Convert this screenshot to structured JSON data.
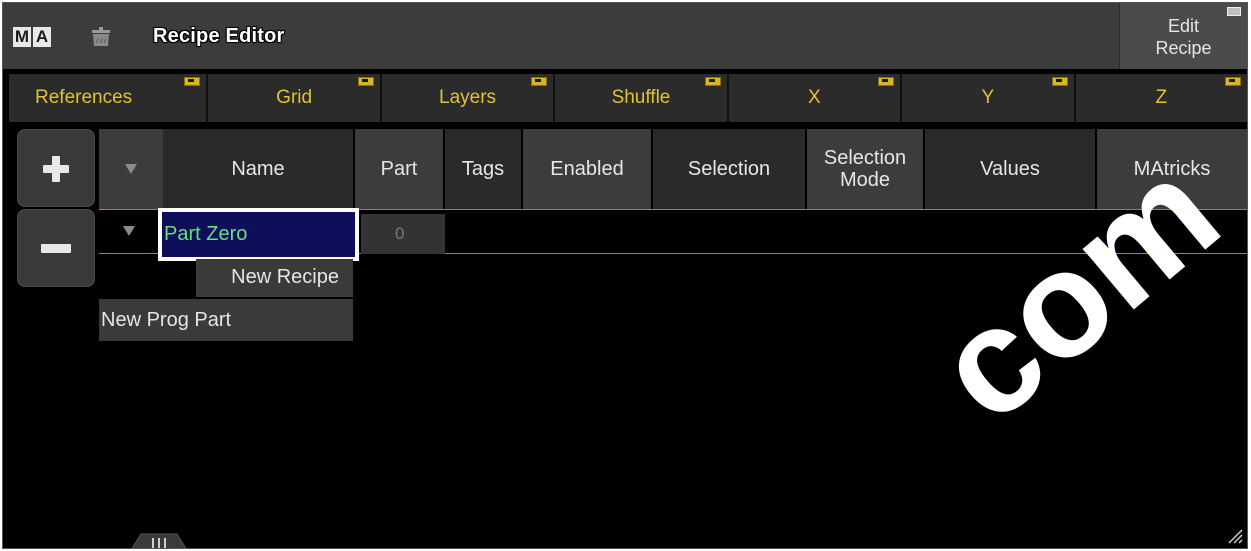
{
  "window": {
    "logo": [
      "M",
      "A"
    ],
    "title": "Recipe Editor",
    "edit_button": {
      "line1": "Edit",
      "line2": "Recipe"
    }
  },
  "tabs": [
    {
      "label": "References"
    },
    {
      "label": "Grid"
    },
    {
      "label": "Layers"
    },
    {
      "label": "Shuffle"
    },
    {
      "label": "X"
    },
    {
      "label": "Y"
    },
    {
      "label": "Z"
    }
  ],
  "columns": {
    "name": "Name",
    "part": "Part",
    "tags": "Tags",
    "enabled": "Enabled",
    "selection": "Selection",
    "selection_mode_line1": "Selection",
    "selection_mode_line2": "Mode",
    "values": "Values",
    "matricks": "MAtricks"
  },
  "rows": [
    {
      "name": "Part Zero",
      "part": "0"
    }
  ],
  "actions": {
    "new_recipe": "New Recipe",
    "new_prog_part": "New Prog Part"
  },
  "colors": {
    "accent": "#e0c234",
    "selected_text": "#66e07a",
    "selected_bg": "#0e0e5a"
  },
  "watermark": "com"
}
